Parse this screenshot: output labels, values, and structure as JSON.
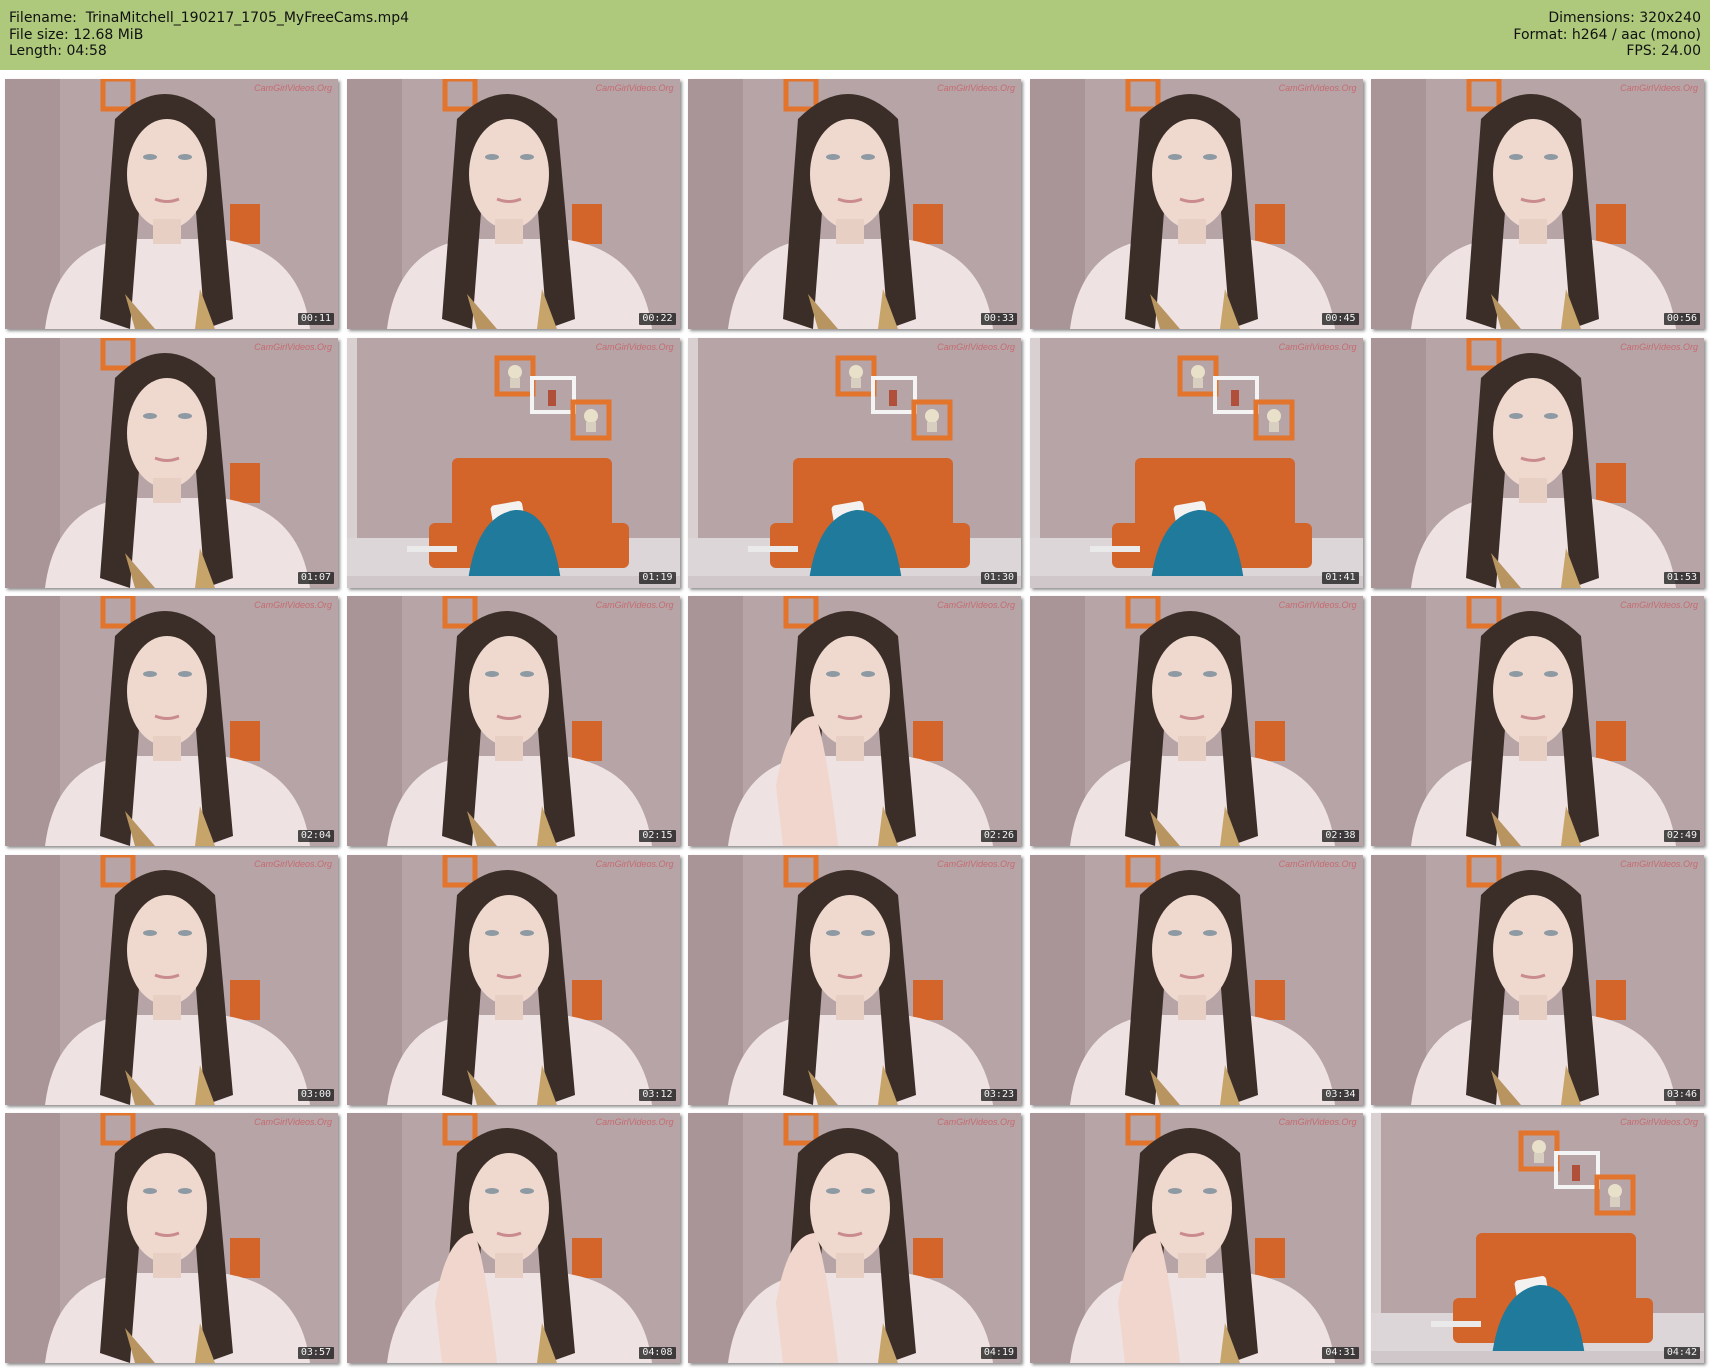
{
  "header": {
    "filename_label": "Filename:",
    "filename": "TrinaMitchell_190217_1705_MyFreeCams.mp4",
    "filesize_label": "File size:",
    "filesize": "12.68 MiB",
    "length_label": "Length:",
    "length": "04:58",
    "dimensions_label": "Dimensions:",
    "dimensions": "320x240",
    "format_label": "Format:",
    "format": "h264 / aac (mono)",
    "fps_label": "FPS:",
    "fps": "24.00"
  },
  "colors": {
    "header_bg": "#aec97c",
    "wall": "#b7a4a6",
    "sofa": "#d3642a",
    "chair": "#1f7a9c",
    "hair": "#3b2e28",
    "shirt": "#efe2e2"
  },
  "watermark": "CamGirlVideos.Org",
  "thumbnails": [
    {
      "time": "00:11",
      "scene": "person"
    },
    {
      "time": "00:22",
      "scene": "person"
    },
    {
      "time": "00:33",
      "scene": "person"
    },
    {
      "time": "00:45",
      "scene": "person"
    },
    {
      "time": "00:56",
      "scene": "person"
    },
    {
      "time": "01:07",
      "scene": "person"
    },
    {
      "time": "01:19",
      "scene": "room"
    },
    {
      "time": "01:30",
      "scene": "room"
    },
    {
      "time": "01:41",
      "scene": "room"
    },
    {
      "time": "01:53",
      "scene": "person"
    },
    {
      "time": "02:04",
      "scene": "person"
    },
    {
      "time": "02:15",
      "scene": "person"
    },
    {
      "time": "02:26",
      "scene": "person-hand"
    },
    {
      "time": "02:38",
      "scene": "person"
    },
    {
      "time": "02:49",
      "scene": "person"
    },
    {
      "time": "03:00",
      "scene": "person"
    },
    {
      "time": "03:12",
      "scene": "person"
    },
    {
      "time": "03:23",
      "scene": "person"
    },
    {
      "time": "03:34",
      "scene": "person"
    },
    {
      "time": "03:46",
      "scene": "person"
    },
    {
      "time": "03:57",
      "scene": "person"
    },
    {
      "time": "04:08",
      "scene": "person-hand"
    },
    {
      "time": "04:19",
      "scene": "person-hand"
    },
    {
      "time": "04:31",
      "scene": "person-hand"
    },
    {
      "time": "04:42",
      "scene": "room"
    }
  ]
}
